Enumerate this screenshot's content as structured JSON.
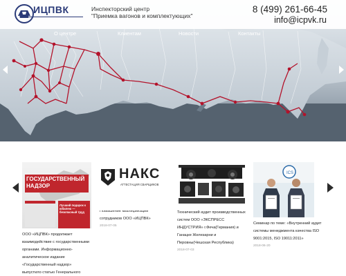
{
  "header": {
    "logo_text": "ИЦПВК",
    "tagline_line1": "Инспекторский центр",
    "tagline_line2": "\"Приемка вагонов и комплектующих\"",
    "phone": "8 (499) 261-66-45",
    "email": "info@icpvk.ru"
  },
  "nav": {
    "items": [
      {
        "label": "О центре"
      },
      {
        "label": "Клиентам"
      },
      {
        "label": "Новости"
      },
      {
        "label": "Контакты"
      }
    ]
  },
  "colors": {
    "brand": "#2a3a78",
    "route": "#b3122a",
    "gov_red": "#c0262d"
  },
  "news": {
    "cards": [
      {
        "text": "ООО «ИЦПВК» продолжает взаимодействие с государственными органами. Информационно-аналитическое издание «Государственный надзор» выпустило статью Генерального директора ООО «ИЦПВК» Асриянца",
        "image_title": "ГОСУДАРСТВЕННЫЙ НАДЗОР",
        "image_caption": "Лучший подарок к юбилею — безопасный труд",
        "date": ""
      },
      {
        "text": "Повышение квалификации сотрудников ООО «ИЦПВК»",
        "image_title": "НАКС",
        "image_caption": "АТТЕСТАЦИЯ СВАРЩИКОВ",
        "date": "2018-07-05"
      },
      {
        "text": "Технический аудит производственных систем ООО «ЭКСПРЕСС ИНДУСТРИЯ» г.Феча(Германия) и Ганацке Железарни и Перовны(Чешская Республика)",
        "date": "2018-07-03"
      },
      {
        "text": "Семинар по теме: «Внутренний аудит системы менеджмента качества ISO 9001:2015, ISO 19011:2011»",
        "date": "2018-06-20"
      }
    ]
  }
}
